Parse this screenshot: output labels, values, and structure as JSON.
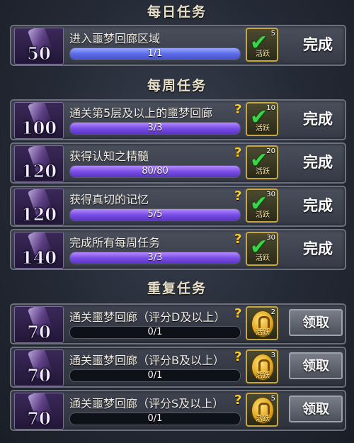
{
  "sections": {
    "daily": "每日任务",
    "weekly": "每周任务",
    "repeat": "重复任务"
  },
  "colors": {
    "done_check": "#3ad64a",
    "bar_daily": "#5b6be8",
    "bar_weekly": "#7a4ee6",
    "help_mark": "#ffcc1c"
  },
  "daily": [
    {
      "points": "50",
      "name": "进入噩梦回廊区域",
      "progress": "1/1",
      "progress_ratio": 1.0,
      "reward_label": "活跃",
      "reward_count": "5",
      "status": "完成"
    }
  ],
  "weekly": [
    {
      "points": "100",
      "name": "通关第5层及以上的噩梦回廊",
      "help": "?",
      "progress": "3/3",
      "progress_ratio": 1.0,
      "reward_label": "活跃",
      "reward_count": "10",
      "status": "完成"
    },
    {
      "points": "120",
      "name": "获得认知之精髓",
      "help": "?",
      "progress": "80/80",
      "progress_ratio": 1.0,
      "reward_label": "活跃",
      "reward_count": "20",
      "status": "完成"
    },
    {
      "points": "120",
      "name": "获得真切的记忆",
      "help": "?",
      "progress": "5/5",
      "progress_ratio": 1.0,
      "reward_label": "活跃",
      "reward_count": "30",
      "status": "完成"
    },
    {
      "points": "140",
      "name": "完成所有每周任务",
      "help": "?",
      "progress": "3/3",
      "progress_ratio": 1.0,
      "reward_label": "活跃",
      "reward_count": "30",
      "status": "完成"
    }
  ],
  "repeat": [
    {
      "points": "70",
      "name": "通关噩梦回廊（评分D及以上）",
      "help": "?",
      "progress": "0/1",
      "progress_ratio": 0.0,
      "reward_label": "活跃",
      "reward_count": "2",
      "button": "领取"
    },
    {
      "points": "70",
      "name": "通关噩梦回廊（评分B及以上）",
      "help": "?",
      "progress": "0/1",
      "progress_ratio": 0.0,
      "reward_label": "活跃",
      "reward_count": "3",
      "button": "领取"
    },
    {
      "points": "70",
      "name": "通关噩梦回廊（评分S及以上）",
      "help": "?",
      "progress": "0/1",
      "progress_ratio": 0.0,
      "reward_label": "活跃",
      "reward_count": "5",
      "button": "领取"
    }
  ]
}
